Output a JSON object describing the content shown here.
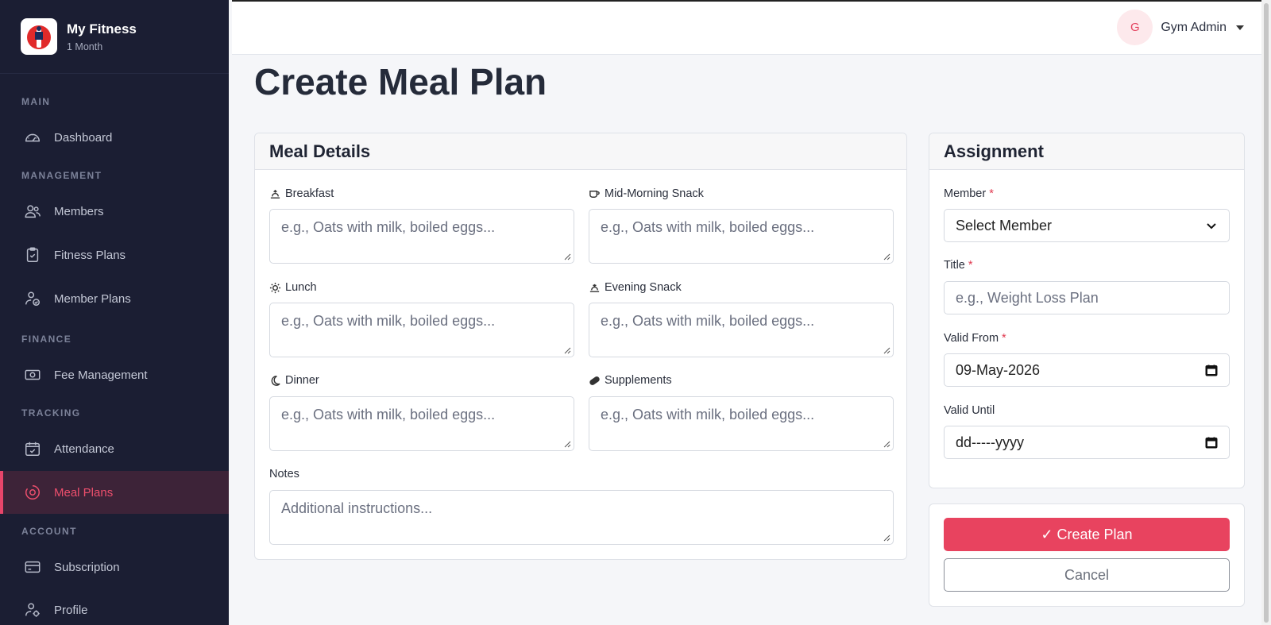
{
  "brand": {
    "name": "My Fitness",
    "subtitle": "1 Month"
  },
  "sidebar": {
    "sections": [
      "MAIN",
      "MANAGEMENT",
      "FINANCE",
      "TRACKING",
      "ACCOUNT"
    ],
    "items": [
      {
        "label": "Dashboard",
        "icon": "speedometer-icon"
      },
      {
        "label": "Members",
        "icon": "people-icon"
      },
      {
        "label": "Fitness Plans",
        "icon": "clipboard-check-icon"
      },
      {
        "label": "Member Plans",
        "icon": "person-check-icon"
      },
      {
        "label": "Fee Management",
        "icon": "cash-icon"
      },
      {
        "label": "Attendance",
        "icon": "calendar-check-icon"
      },
      {
        "label": "Meal Plans",
        "icon": "meal-icon",
        "active": true
      },
      {
        "label": "Subscription",
        "icon": "credit-card-icon"
      },
      {
        "label": "Profile",
        "icon": "person-gear-icon"
      }
    ]
  },
  "topbar": {
    "avatar_initial": "G",
    "user_name": "Gym Admin"
  },
  "page": {
    "title": "Create Meal Plan"
  },
  "meal_details": {
    "header": "Meal Details",
    "fields": [
      {
        "label": "Breakfast",
        "placeholder": "e.g., Oats with milk, boiled eggs...",
        "icon": "sunrise-icon"
      },
      {
        "label": "Mid-Morning Snack",
        "placeholder": "e.g., Oats with milk, boiled eggs...",
        "icon": "cup-icon"
      },
      {
        "label": "Lunch",
        "placeholder": "e.g., Oats with milk, boiled eggs...",
        "icon": "sun-icon"
      },
      {
        "label": "Evening Snack",
        "placeholder": "e.g., Oats with milk, boiled eggs...",
        "icon": "sunset-icon"
      },
      {
        "label": "Dinner",
        "placeholder": "e.g., Oats with milk, boiled eggs...",
        "icon": "moon-icon"
      },
      {
        "label": "Supplements",
        "placeholder": "e.g., Oats with milk, boiled eggs...",
        "icon": "capsule-icon"
      }
    ],
    "notes": {
      "label": "Notes",
      "placeholder": "Additional instructions..."
    }
  },
  "assignment": {
    "header": "Assignment",
    "member": {
      "label": "Member",
      "required": "*",
      "value": "Select Member"
    },
    "title": {
      "label": "Title",
      "required": "*",
      "placeholder": "e.g., Weight Loss Plan"
    },
    "valid_from": {
      "label": "Valid From",
      "required": "*",
      "value": "09-May-2026"
    },
    "valid_until": {
      "label": "Valid Until",
      "value": "dd-----yyyy"
    }
  },
  "actions": {
    "create_label": "✓ Create Plan",
    "cancel_label": "Cancel"
  },
  "colors": {
    "sidebar_bg": "#1b1e33",
    "accent": "#e8435f",
    "page_bg": "#f5f6f9"
  }
}
